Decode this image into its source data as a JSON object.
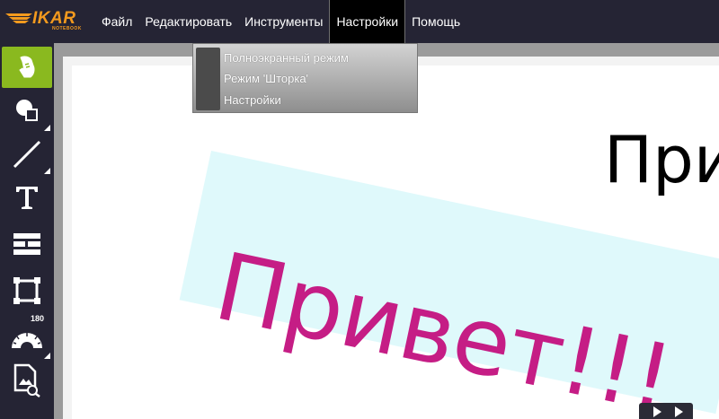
{
  "app": {
    "logo": {
      "text": "IKAR",
      "subtext": "NOTEBOOK"
    }
  },
  "menu": {
    "items": [
      {
        "label": "Файл"
      },
      {
        "label": "Редактировать"
      },
      {
        "label": "Инструменты"
      },
      {
        "label": "Настройки",
        "active": true
      },
      {
        "label": "Помощь"
      }
    ]
  },
  "dropdown": {
    "items": [
      {
        "label": "Полноэкранный режим"
      },
      {
        "label": "Режим 'Шторка'"
      },
      {
        "label": "Настройки"
      }
    ]
  },
  "toolbar": {
    "tools": [
      {
        "icon": "hand-pointer-icon",
        "active": true
      },
      {
        "icon": "shapes-icon"
      },
      {
        "icon": "line-icon"
      },
      {
        "icon": "text-icon"
      },
      {
        "icon": "table-layout-icon"
      },
      {
        "icon": "frame-icon"
      },
      {
        "icon": "protractor-icon",
        "badge": "180"
      },
      {
        "icon": "image-search-icon"
      }
    ]
  },
  "canvas": {
    "heading_fragment": "При",
    "note_text": "Привет!!!"
  },
  "colors": {
    "menubar": "#252434",
    "accent_green": "#8ab91f",
    "logo_orange": "#f39a1e",
    "note_background": "#dff9fb",
    "note_text": "#c51d85"
  }
}
